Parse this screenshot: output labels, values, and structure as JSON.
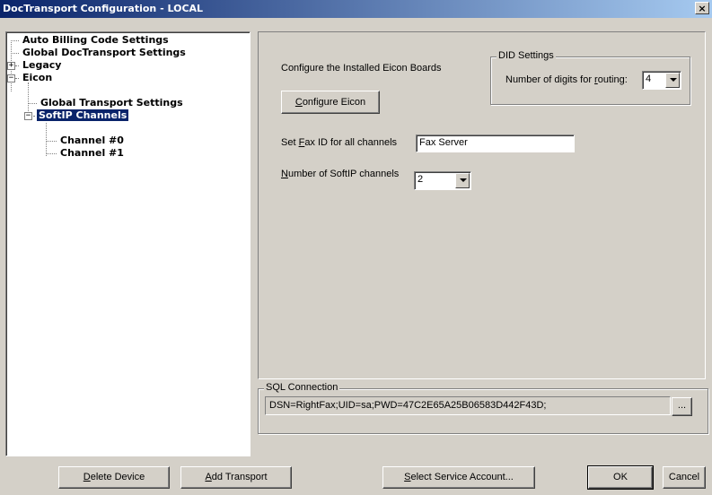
{
  "window": {
    "title": "DocTransport Configuration - LOCAL",
    "close_label": "×"
  },
  "tree": {
    "items": [
      {
        "label": "Auto Billing Code Settings"
      },
      {
        "label": "Global DocTransport Settings"
      },
      {
        "label": "Legacy",
        "expander": "+"
      },
      {
        "label": "Eicon",
        "expander": "−"
      },
      {
        "label": "Global Transport Settings"
      },
      {
        "label": "SoftIP Channels",
        "expander": "−",
        "selected": true
      },
      {
        "label": "Channel #0"
      },
      {
        "label": "Channel #1"
      }
    ]
  },
  "panel": {
    "configure_text": "Configure the Installed Eicon Boards",
    "configure_button": {
      "pre": "",
      "accel": "C",
      "post": "onfigure Eicon"
    },
    "did": {
      "group_label": "DID Settings",
      "digits_label": {
        "pre": "Number of digits for ",
        "accel": "r",
        "post": "outing:"
      },
      "digits_value": "4"
    },
    "fax_id": {
      "label": {
        "pre": "Set ",
        "accel": "F",
        "post": "ax ID for all channels"
      },
      "value": "Fax Server"
    },
    "softip_channels": {
      "label": {
        "pre": "",
        "accel": "N",
        "post": "umber of SoftIP channels"
      },
      "value": "2"
    }
  },
  "sql": {
    "group_label": "SQL Connection",
    "value": "DSN=RightFax;UID=sa;PWD=47C2E65A25B06583D442F43D;",
    "browse_label": "..."
  },
  "buttons": {
    "delete_device": {
      "pre": "",
      "accel": "D",
      "post": "elete Device"
    },
    "add_transport": {
      "pre": "",
      "accel": "A",
      "post": "dd Transport"
    },
    "select_service_account": {
      "pre": "",
      "accel": "S",
      "post": "elect Service Account..."
    },
    "ok": "OK",
    "cancel": "Cancel"
  }
}
